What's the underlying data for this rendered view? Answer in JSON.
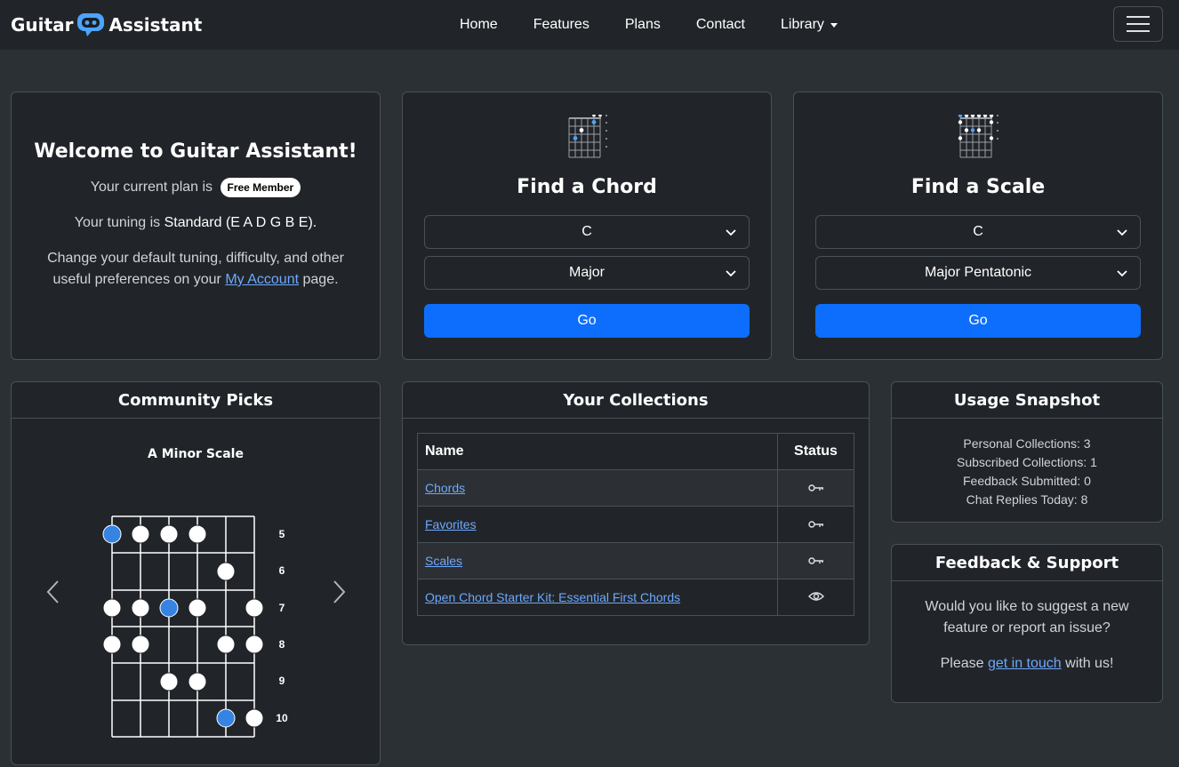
{
  "navbar": {
    "brand_left": "Guitar",
    "brand_right": "Assistant",
    "links": [
      "Home",
      "Features",
      "Plans",
      "Contact"
    ],
    "library_label": "Library"
  },
  "welcome": {
    "title": "Welcome to Guitar Assistant!",
    "plan_prefix": "Your current plan is",
    "plan_badge": "Free Member",
    "tuning_prefix": "Your tuning is",
    "tuning_value": "Standard (E A D G B E).",
    "prefs_line1": "Change your default tuning, difficulty, and other",
    "prefs_line2_prefix": "useful preferences on your",
    "account_link": "My Account",
    "prefs_line2_suffix": "page."
  },
  "chord_finder": {
    "title": "Find a Chord",
    "root": "C",
    "quality": "Major",
    "button": "Go"
  },
  "scale_finder": {
    "title": "Find a Scale",
    "root": "C",
    "scale": "Major Pentatonic",
    "button": "Go"
  },
  "community_picks": {
    "title": "Community Picks",
    "item_title": "A Minor Scale",
    "fret_labels": [
      "5",
      "6",
      "7",
      "8",
      "9",
      "10"
    ]
  },
  "collections": {
    "title": "Your Collections",
    "columns": [
      "Name",
      "Status"
    ],
    "rows": [
      {
        "name": "Chords",
        "status_icon": "key-icon"
      },
      {
        "name": "Favorites",
        "status_icon": "key-icon"
      },
      {
        "name": "Scales",
        "status_icon": "key-icon"
      },
      {
        "name": "Open Chord Starter Kit: Essential First Chords",
        "status_icon": "eye-icon"
      }
    ]
  },
  "usage": {
    "title": "Usage Snapshot",
    "personal": "Personal Collections: 3",
    "subscribed": "Subscribed Collections: 1",
    "feedback": "Feedback Submitted: 0",
    "chat": "Chat Replies Today: 8"
  },
  "feedback_support": {
    "title": "Feedback & Support",
    "line1": "Would you like to suggest a new",
    "line2": "feature or report an issue?",
    "please": "Please",
    "link": "get in touch",
    "suffix": "with us!"
  },
  "colors": {
    "accent": "#0d6efd",
    "link": "#6ea8fe",
    "root_note": "#3584e4"
  }
}
